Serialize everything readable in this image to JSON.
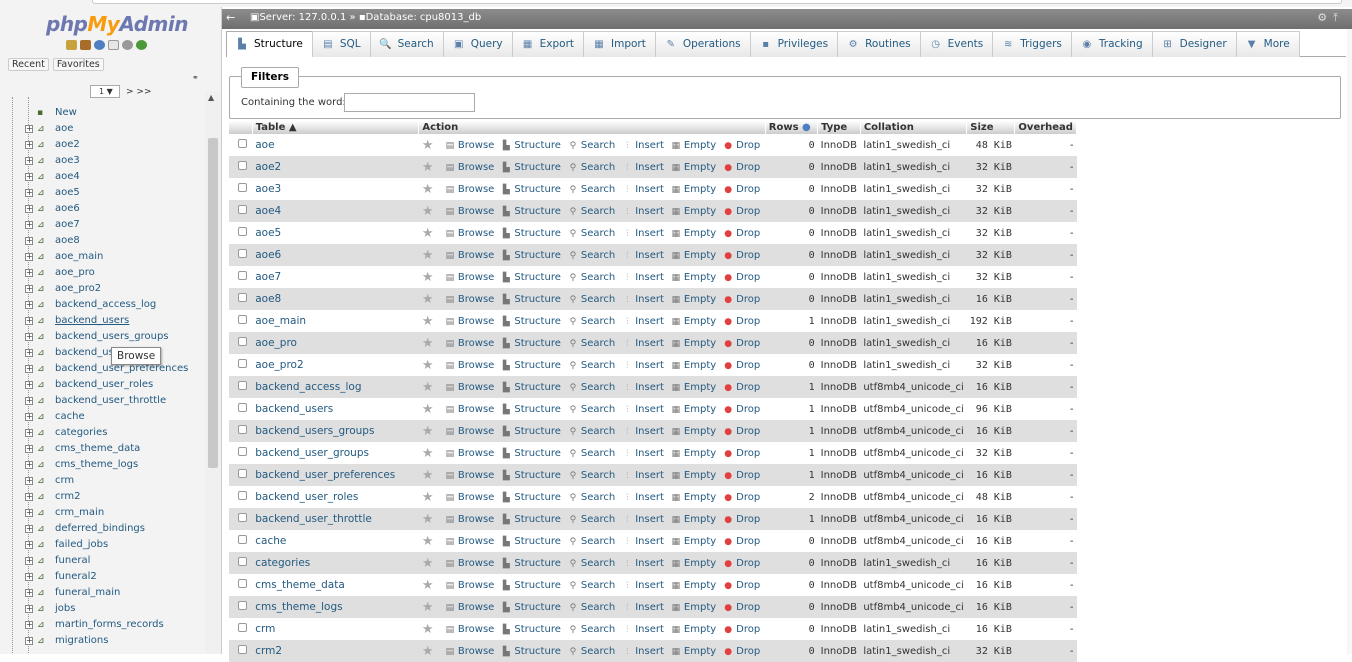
{
  "app": {
    "logo_php": "php",
    "logo_my": "My",
    "logo_admin": "Admin"
  },
  "nav": {
    "recent": "Recent",
    "favorites": "Favorites",
    "page_select": "1 ▼",
    "page_next": "> >>",
    "new_label": "New",
    "tables": [
      "aoe",
      "aoe2",
      "aoe3",
      "aoe4",
      "aoe5",
      "aoe6",
      "aoe7",
      "aoe8",
      "aoe_main",
      "aoe_pro",
      "aoe_pro2",
      "backend_access_log",
      "backend_users",
      "backend_users_groups",
      "backend_us",
      "backend_user_preferences",
      "backend_user_roles",
      "backend_user_throttle",
      "cache",
      "categories",
      "cms_theme_data",
      "cms_theme_logs",
      "crm",
      "crm2",
      "crm_main",
      "deferred_bindings",
      "failed_jobs",
      "funeral",
      "funeral2",
      "funeral_main",
      "jobs",
      "martin_forms_records",
      "migrations"
    ],
    "tooltip": "Browse"
  },
  "breadcrumb": {
    "server": "Server: 127.0.0.1",
    "sep": "»",
    "database": "Database: cpu8013_db"
  },
  "tabs": [
    {
      "label": "Structure",
      "icon": "structure-icon",
      "glyph": "▙",
      "active": true
    },
    {
      "label": "SQL",
      "icon": "sql-icon",
      "glyph": "▤",
      "active": false
    },
    {
      "label": "Search",
      "icon": "search-icon",
      "glyph": "🔍",
      "active": false
    },
    {
      "label": "Query",
      "icon": "query-icon",
      "glyph": "▣",
      "active": false
    },
    {
      "label": "Export",
      "icon": "export-icon",
      "glyph": "▦",
      "active": false
    },
    {
      "label": "Import",
      "icon": "import-icon",
      "glyph": "▦",
      "active": false
    },
    {
      "label": "Operations",
      "icon": "wrench-icon",
      "glyph": "✎",
      "active": false
    },
    {
      "label": "Privileges",
      "icon": "privileges-icon",
      "glyph": "▪",
      "active": false
    },
    {
      "label": "Routines",
      "icon": "routines-icon",
      "glyph": "⚙",
      "active": false
    },
    {
      "label": "Events",
      "icon": "events-icon",
      "glyph": "◷",
      "active": false
    },
    {
      "label": "Triggers",
      "icon": "triggers-icon",
      "glyph": "≋",
      "active": false
    },
    {
      "label": "Tracking",
      "icon": "tracking-icon",
      "glyph": "◉",
      "active": false
    },
    {
      "label": "Designer",
      "icon": "designer-icon",
      "glyph": "⊞",
      "active": false
    },
    {
      "label": "More",
      "icon": "more-icon",
      "glyph": "▼",
      "active": false
    }
  ],
  "filters": {
    "legend": "Filters",
    "containing_label": "Containing the word:",
    "input_value": ""
  },
  "columns": {
    "table": "Table ▲",
    "action": "Action",
    "rows": "Rows",
    "type": "Type",
    "collation": "Collation",
    "size": "Size",
    "overhead": "Overhead"
  },
  "actions": {
    "browse": "Browse",
    "structure": "Structure",
    "search": "Search",
    "insert": "Insert",
    "empty": "Empty",
    "drop": "Drop"
  },
  "rows": [
    {
      "name": "aoe",
      "rows": "0",
      "type": "InnoDB",
      "collation": "latin1_swedish_ci",
      "size": "48 KiB",
      "overhead": "-"
    },
    {
      "name": "aoe2",
      "rows": "0",
      "type": "InnoDB",
      "collation": "latin1_swedish_ci",
      "size": "32 KiB",
      "overhead": "-"
    },
    {
      "name": "aoe3",
      "rows": "0",
      "type": "InnoDB",
      "collation": "latin1_swedish_ci",
      "size": "32 KiB",
      "overhead": "-"
    },
    {
      "name": "aoe4",
      "rows": "0",
      "type": "InnoDB",
      "collation": "latin1_swedish_ci",
      "size": "32 KiB",
      "overhead": "-"
    },
    {
      "name": "aoe5",
      "rows": "0",
      "type": "InnoDB",
      "collation": "latin1_swedish_ci",
      "size": "32 KiB",
      "overhead": "-"
    },
    {
      "name": "aoe6",
      "rows": "0",
      "type": "InnoDB",
      "collation": "latin1_swedish_ci",
      "size": "32 KiB",
      "overhead": "-"
    },
    {
      "name": "aoe7",
      "rows": "0",
      "type": "InnoDB",
      "collation": "latin1_swedish_ci",
      "size": "32 KiB",
      "overhead": "-"
    },
    {
      "name": "aoe8",
      "rows": "0",
      "type": "InnoDB",
      "collation": "latin1_swedish_ci",
      "size": "16 KiB",
      "overhead": "-"
    },
    {
      "name": "aoe_main",
      "rows": "1",
      "type": "InnoDB",
      "collation": "latin1_swedish_ci",
      "size": "192 KiB",
      "overhead": "-"
    },
    {
      "name": "aoe_pro",
      "rows": "0",
      "type": "InnoDB",
      "collation": "latin1_swedish_ci",
      "size": "16 KiB",
      "overhead": "-"
    },
    {
      "name": "aoe_pro2",
      "rows": "0",
      "type": "InnoDB",
      "collation": "latin1_swedish_ci",
      "size": "32 KiB",
      "overhead": "-"
    },
    {
      "name": "backend_access_log",
      "rows": "1",
      "type": "InnoDB",
      "collation": "utf8mb4_unicode_ci",
      "size": "16 KiB",
      "overhead": "-"
    },
    {
      "name": "backend_users",
      "rows": "1",
      "type": "InnoDB",
      "collation": "utf8mb4_unicode_ci",
      "size": "96 KiB",
      "overhead": "-"
    },
    {
      "name": "backend_users_groups",
      "rows": "1",
      "type": "InnoDB",
      "collation": "utf8mb4_unicode_ci",
      "size": "16 KiB",
      "overhead": "-"
    },
    {
      "name": "backend_user_groups",
      "rows": "1",
      "type": "InnoDB",
      "collation": "utf8mb4_unicode_ci",
      "size": "32 KiB",
      "overhead": "-"
    },
    {
      "name": "backend_user_preferences",
      "rows": "1",
      "type": "InnoDB",
      "collation": "utf8mb4_unicode_ci",
      "size": "16 KiB",
      "overhead": "-"
    },
    {
      "name": "backend_user_roles",
      "rows": "2",
      "type": "InnoDB",
      "collation": "utf8mb4_unicode_ci",
      "size": "48 KiB",
      "overhead": "-"
    },
    {
      "name": "backend_user_throttle",
      "rows": "1",
      "type": "InnoDB",
      "collation": "utf8mb4_unicode_ci",
      "size": "16 KiB",
      "overhead": "-"
    },
    {
      "name": "cache",
      "rows": "0",
      "type": "InnoDB",
      "collation": "utf8mb4_unicode_ci",
      "size": "16 KiB",
      "overhead": "-"
    },
    {
      "name": "categories",
      "rows": "0",
      "type": "InnoDB",
      "collation": "latin1_swedish_ci",
      "size": "16 KiB",
      "overhead": "-"
    },
    {
      "name": "cms_theme_data",
      "rows": "0",
      "type": "InnoDB",
      "collation": "utf8mb4_unicode_ci",
      "size": "16 KiB",
      "overhead": "-"
    },
    {
      "name": "cms_theme_logs",
      "rows": "0",
      "type": "InnoDB",
      "collation": "utf8mb4_unicode_ci",
      "size": "16 KiB",
      "overhead": "-"
    },
    {
      "name": "crm",
      "rows": "0",
      "type": "InnoDB",
      "collation": "latin1_swedish_ci",
      "size": "16 KiB",
      "overhead": "-"
    },
    {
      "name": "crm2",
      "rows": "0",
      "type": "InnoDB",
      "collation": "latin1_swedish_ci",
      "size": "32 KiB",
      "overhead": "-"
    }
  ]
}
